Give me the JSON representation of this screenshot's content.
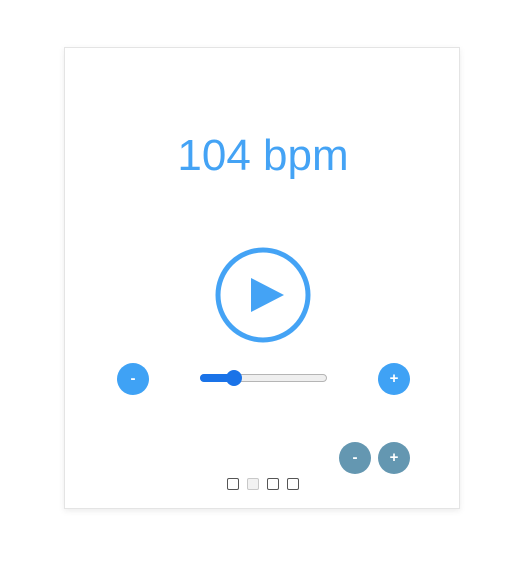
{
  "tempo": {
    "display": "104 bpm",
    "slider_fraction": 0.27
  },
  "controls": {
    "play_icon": "play-icon",
    "tempo_decrease_label": "-",
    "tempo_increase_label": "+",
    "secondary_decrease_label": "-",
    "secondary_increase_label": "+"
  },
  "beats": {
    "count": 4,
    "active_index": 1
  },
  "colors": {
    "accent": "#44a3f5",
    "button_blue": "#3fa2f5",
    "button_gray": "#6497b1",
    "slider_fill": "#1a73e8"
  }
}
